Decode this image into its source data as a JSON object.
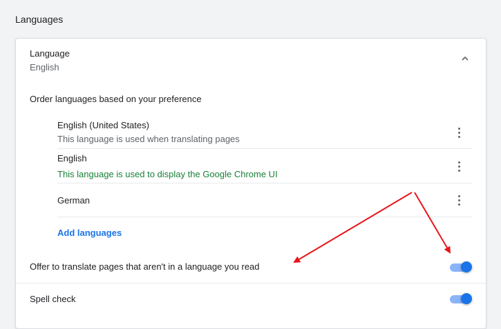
{
  "section": {
    "title": "Languages"
  },
  "language_card": {
    "header_label": "Language",
    "header_value": "English",
    "expanded": true,
    "order_label": "Order languages based on your preference",
    "languages": [
      {
        "name": "English (United States)",
        "description": "This language is used when translating pages",
        "description_color": "#5f6368"
      },
      {
        "name": "English",
        "description": "This language is used to display the Google Chrome UI",
        "description_color": "#188038"
      },
      {
        "name": "German",
        "description": ""
      }
    ],
    "add_languages_label": "Add languages"
  },
  "offer_translate": {
    "label": "Offer to translate pages that aren't in a language you read",
    "enabled": true
  },
  "spell_check": {
    "label": "Spell check",
    "enabled": true
  },
  "colors": {
    "accent": "#1a73e8",
    "toggle_track": "#8ab4f8",
    "annotation_arrow": "#e8141a",
    "secondary_text": "#5f6368",
    "ui_language_text": "#188038"
  },
  "icons": {
    "collapse": "chevron-up-icon",
    "more_actions": "kebab-menu-icon"
  }
}
